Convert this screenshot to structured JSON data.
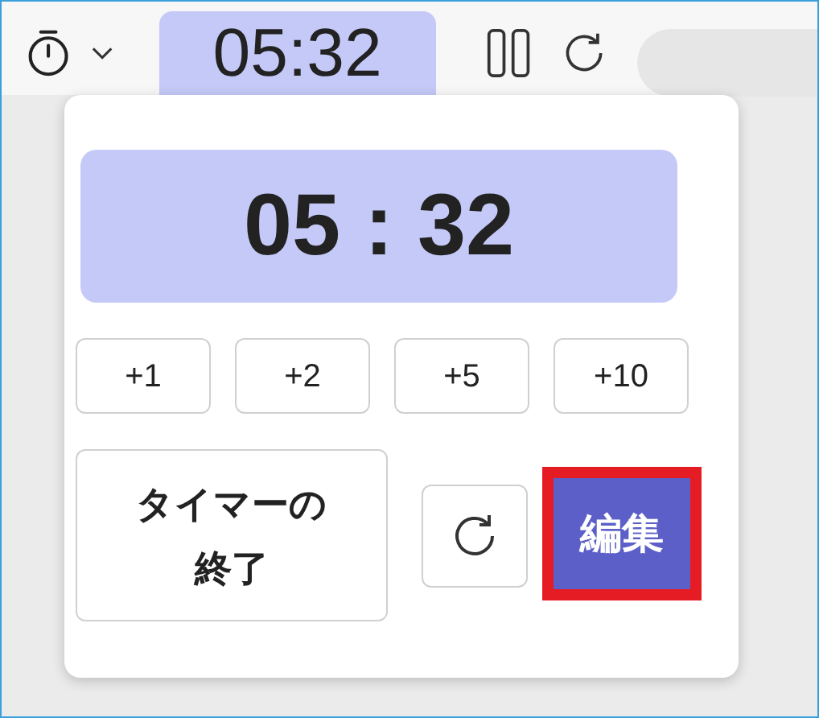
{
  "toolbar": {
    "time": "05:32"
  },
  "panel": {
    "display": "05 : 32",
    "increments": [
      "+1",
      "+2",
      "+5",
      "+10"
    ],
    "end_button": "タイマーの終了",
    "edit_button": {
      "label": "編集",
      "highlighted": true
    }
  }
}
